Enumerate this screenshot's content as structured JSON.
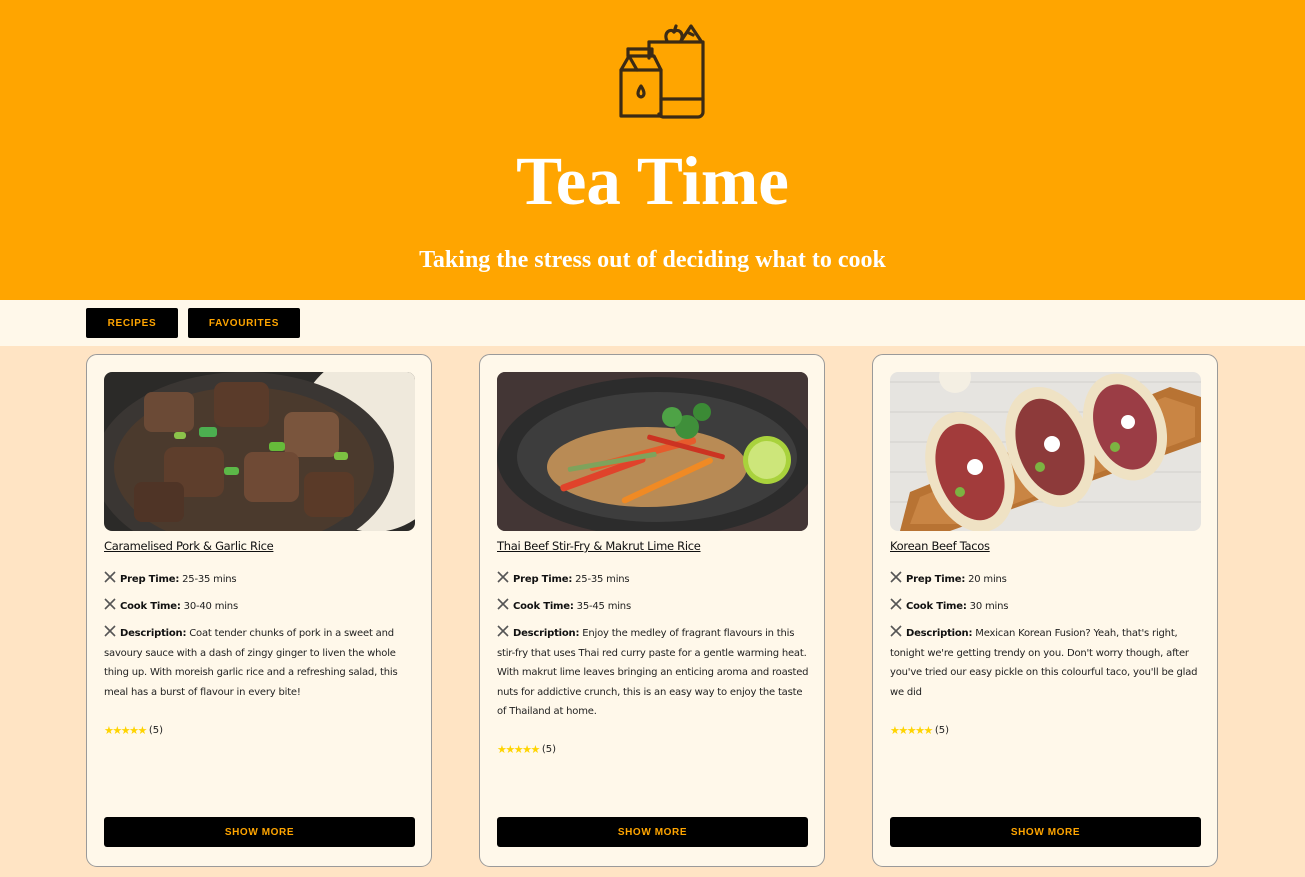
{
  "header": {
    "logo_icon": "grocery-bag-icon",
    "title": "Tea Time",
    "subtitle": "Taking the stress out of deciding what to cook"
  },
  "nav": {
    "recipes_label": "RECIPES",
    "favourites_label": "FAVOURITES"
  },
  "recipes": [
    {
      "title": "Caramelised Pork & Garlic Rice",
      "prep_label": "Prep Time:",
      "prep": "25-35 mins",
      "cook_label": "Cook Time:",
      "cook": "30-40 mins",
      "desc_label": "Description:",
      "description": "Coat tender chunks of pork in a sweet and savoury sauce with a dash of zingy ginger to liven the whole thing up. With moreish garlic rice and a refreshing salad, this meal has a burst of flavour in every bite!",
      "stars": 5,
      "rating_count": "(5)",
      "button": "SHOW MORE"
    },
    {
      "title": "Thai Beef Stir-Fry & Makrut Lime Rice",
      "prep_label": "Prep Time:",
      "prep": "25-35 mins",
      "cook_label": "Cook Time:",
      "cook": "35-45 mins",
      "desc_label": "Description:",
      "description": "Enjoy the medley of fragrant flavours in this stir-fry that uses Thai red curry paste for a gentle warming heat. With makrut lime leaves bringing an enticing aroma and roasted nuts for addictive crunch, this is an easy way to enjoy the taste of Thailand at home.",
      "stars": 5,
      "rating_count": "(5)",
      "button": "SHOW MORE"
    },
    {
      "title": "Korean Beef Tacos",
      "prep_label": "Prep Time:",
      "prep": "20 mins",
      "cook_label": "Cook Time:",
      "cook": "30 mins",
      "desc_label": "Description:",
      "description": "Mexican Korean Fusion? Yeah, that's right, tonight we're getting trendy on you. Don't worry though, after you've tried our easy pickle on this colourful taco, you'll be glad we did",
      "stars": 5,
      "rating_count": "(5)",
      "button": "SHOW MORE"
    }
  ],
  "colors": {
    "header_bg": "#ffa500",
    "nav_bg": "#fff8ea",
    "page_bg": "#ffe4c4",
    "button_bg": "#000000",
    "button_text": "#ffa500",
    "star": "#ffd400"
  }
}
